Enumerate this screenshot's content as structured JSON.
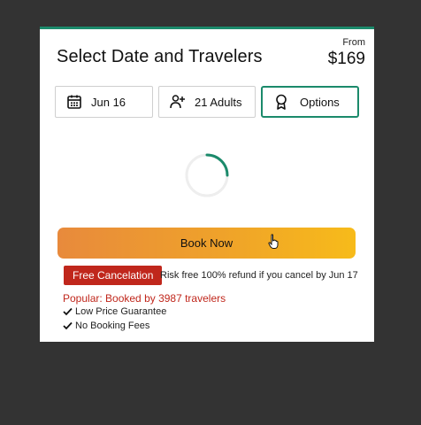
{
  "header": {
    "title": "Select Date and Travelers",
    "from_label": "From",
    "price": "$169"
  },
  "selectors": {
    "date": {
      "label": "Jun 16",
      "icon": "calendar-icon"
    },
    "travelers": {
      "label": "21 Adults",
      "icon": "add-user-icon"
    },
    "options": {
      "label": "Options",
      "icon": "award-icon"
    }
  },
  "loading": {
    "icon": "loading-spinner"
  },
  "cta": {
    "book_label": "Book Now"
  },
  "cancellation": {
    "badge": "Free Cancelation",
    "text": "Risk free 100% refund if you cancel by Jun 17"
  },
  "popularity": {
    "text": "Popular: Booked by 3987 travelers"
  },
  "features": [
    {
      "label": "Low Price Guarantee",
      "icon": "check-icon"
    },
    {
      "label": "No Booking Fees",
      "icon": "check-icon"
    }
  ],
  "colors": {
    "accent": "#1b8a6b",
    "badge": "#c0271c",
    "button_start": "#e88a3c",
    "button_end": "#f7bb1a",
    "backdrop": "#333333"
  }
}
